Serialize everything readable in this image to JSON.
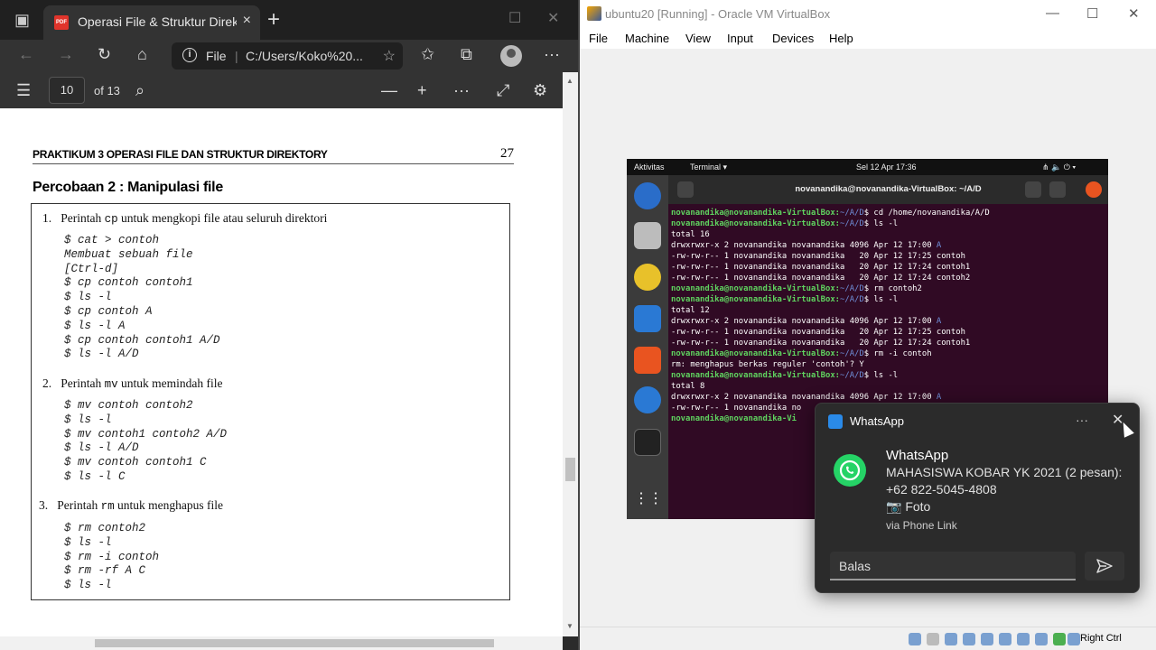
{
  "browser": {
    "tab_title": "Operasi File & Struktur Direktori",
    "tab_close": "×",
    "new_tab": "+",
    "address_label": "File",
    "url": "C:/Users/Koko%20...",
    "pdf_page": "10",
    "pdf_page_of": "of 13"
  },
  "document": {
    "header": "PRAKTIKUM 3  OPERASI FILE DAN STRUKTUR DIREKTORY",
    "page_number": "27",
    "subtitle": "Percobaan 2 : Manipulasi file",
    "items": [
      {
        "num": "1.",
        "pre": "Perintah ",
        "cmd": "cp",
        "post": " untuk mengkopi file atau seluruh direktori",
        "code": "$ cat > contoh\nMembuat sebuah file\n[Ctrl-d]\n$ cp contoh contoh1\n$ ls -l\n$ cp contoh A\n$ ls -l A\n$ cp contoh contoh1 A/D\n$ ls -l A/D"
      },
      {
        "num": "2.",
        "pre": "Perintah ",
        "cmd": "mv",
        "post": " untuk memindah file",
        "code": "$ mv contoh contoh2\n$ ls -l\n$ mv contoh1 contoh2 A/D\n$ ls -l A/D\n$ mv contoh contoh1 C\n$ ls -l C"
      },
      {
        "num": "3.",
        "pre": "Perintah ",
        "cmd": "rm",
        "post": " untuk menghapus file",
        "code": "$ rm contoh2\n$ ls -l\n$ rm -i contoh\n$ rm -rf A C\n$ ls -l"
      }
    ]
  },
  "virtualbox": {
    "title": "ubuntu20 [Running] - Oracle VM VirtualBox",
    "menu": [
      "File",
      "Machine",
      "View",
      "Input",
      "Devices",
      "Help"
    ],
    "status_right": "Right Ctrl"
  },
  "ubuntu": {
    "activities": "Aktivitas",
    "app_menu": "Terminal ▾",
    "clock": "Sel 12 Apr  17:36",
    "terminal_title": "novanandika@novanandika-VirtualBox: ~/A/D",
    "lines": [
      {
        "prompt": "novanandika@novanandika-VirtualBox:",
        "path": "~/A/D",
        "text": "$ cd /home/novanandika/A/D"
      },
      {
        "prompt": "novanandika@novanandika-VirtualBox:",
        "path": "~/A/D",
        "text": "$ ls -l"
      },
      {
        "text": "total 16"
      },
      {
        "text": "drwxrwxr-x 2 novanandika novanandika 4096 Apr 12 17:00 ",
        "dir": "A"
      },
      {
        "text": "-rw-rw-r-- 1 novanandika novanandika   20 Apr 12 17:25 contoh"
      },
      {
        "text": "-rw-rw-r-- 1 novanandika novanandika   20 Apr 12 17:24 contoh1"
      },
      {
        "text": "-rw-rw-r-- 1 novanandika novanandika   20 Apr 12 17:24 contoh2"
      },
      {
        "prompt": "novanandika@novanandika-VirtualBox:",
        "path": "~/A/D",
        "text": "$ rm contoh2"
      },
      {
        "prompt": "novanandika@novanandika-VirtualBox:",
        "path": "~/A/D",
        "text": "$ ls -l"
      },
      {
        "text": "total 12"
      },
      {
        "text": "drwxrwxr-x 2 novanandika novanandika 4096 Apr 12 17:00 ",
        "dir": "A"
      },
      {
        "text": "-rw-rw-r-- 1 novanandika novanandika   20 Apr 12 17:25 contoh"
      },
      {
        "text": "-rw-rw-r-- 1 novanandika novanandika   20 Apr 12 17:24 contoh1"
      },
      {
        "prompt": "novanandika@novanandika-VirtualBox:",
        "path": "~/A/D",
        "text": "$ rm -i contoh"
      },
      {
        "text": "rm: menghapus berkas reguler 'contoh'? Y"
      },
      {
        "prompt": "novanandika@novanandika-VirtualBox:",
        "path": "~/A/D",
        "text": "$ ls -l"
      },
      {
        "text": "total 8"
      },
      {
        "text": "drwxrwxr-x 2 novanandika novanandika 4096 Apr 12 17:00 ",
        "dir": "A"
      },
      {
        "text": "-rw-rw-r-- 1 novanandika no"
      },
      {
        "prompt": "novanandika@novanandika-Vi",
        "path": "",
        "text": ""
      }
    ]
  },
  "notification": {
    "app": "WhatsApp",
    "more": "···",
    "close": "✕",
    "title": "WhatsApp",
    "line1": "MAHASISWA KOBAR YK 2021 (2 pesan):",
    "line2": "+62 822-5045-4808",
    "line3": "📷 Foto",
    "via": "via Phone Link",
    "reply_placeholder": "Balas"
  },
  "colors": {
    "terminal_bg": "#300a24",
    "prompt_green": "#5fd35f",
    "path_blue": "#6f8fd9",
    "whatsapp_green": "#25d366"
  }
}
